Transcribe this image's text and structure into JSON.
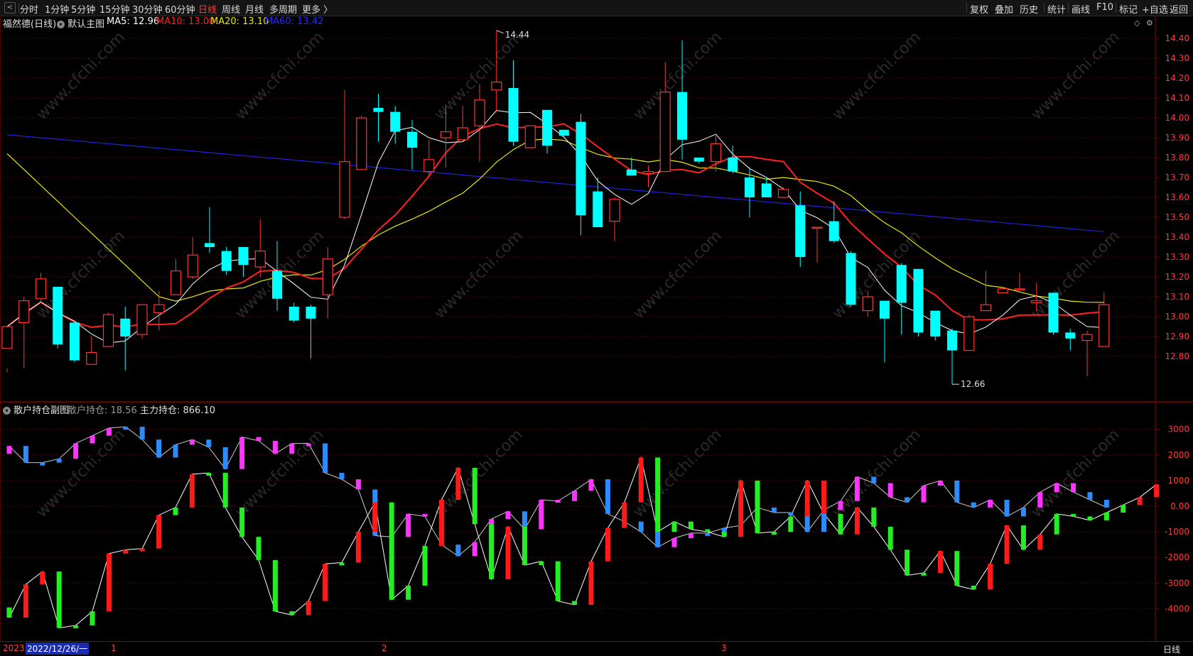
{
  "toolbar": {
    "periods": [
      "分时",
      "1分钟",
      "5分钟",
      "15分钟",
      "30分钟",
      "60分钟",
      "日线",
      "周线",
      "月线",
      "多周期",
      "更多 〉"
    ],
    "active_period": "日线",
    "right_buttons": [
      "复权",
      "叠加",
      "历史",
      "统计",
      "画线",
      "F10",
      "标记",
      "+自选",
      "返回"
    ]
  },
  "main_chart": {
    "stock_title": "福然德(日线)",
    "indicator_name": "默认主图",
    "ma_labels": [
      {
        "text": "MA5: 12.96",
        "color": "#ffffff"
      },
      {
        "text": "MA10: 13.00",
        "color": "#ff2020"
      },
      {
        "text": "MA20: 13.10",
        "color": "#e8e800"
      },
      {
        "text": "MA60: 13.42",
        "color": "#2a2aff"
      }
    ],
    "price_axis": [
      "14.40",
      "14.30",
      "14.20",
      "14.10",
      "14.00",
      "13.90",
      "13.80",
      "13.70",
      "13.60",
      "13.50",
      "13.40",
      "13.30",
      "13.20",
      "13.10",
      "13.00",
      "12.90",
      "12.80"
    ],
    "high_label": "14.44",
    "low_label": "12.66"
  },
  "sub_chart": {
    "indicator_name": "散户持仓副图",
    "label_retail": "散户持仓: 18.56",
    "label_main": "主力持仓: 866.10",
    "axis": [
      "3000",
      "2000",
      "1000",
      "0.00",
      "-1000",
      "-2000",
      "-3000",
      "-4000"
    ]
  },
  "bottom": {
    "year_label": "2023",
    "cursor_date": "2022/12/26/一",
    "month_marks": [
      "1",
      "2",
      "3"
    ],
    "period_label": "日线"
  },
  "watermark": "www.cfchi.com",
  "colors": {
    "up": "#ff3232",
    "down": "#00ffff",
    "ma5": "#ffffff",
    "ma10": "#ff2020",
    "ma20": "#e8e800",
    "ma60": "#2020e0",
    "grid": "#5a0000",
    "axis_line": "#8a0000"
  },
  "chart_data": {
    "type": "candlestick",
    "candles": [
      [
        12.84,
        12.95,
        12.74,
        12.72
      ],
      [
        12.97,
        13.08,
        13.1,
        12.74
      ],
      [
        13.09,
        13.19,
        13.22,
        13.07
      ],
      [
        13.15,
        12.86,
        13.15,
        12.84
      ],
      [
        12.97,
        12.78,
        12.97,
        12.77
      ],
      [
        12.76,
        12.82,
        12.9,
        12.76
      ],
      [
        12.85,
        13.01,
        13.02,
        12.85
      ],
      [
        12.99,
        12.9,
        13.05,
        12.73
      ],
      [
        12.91,
        13.06,
        13.06,
        12.89
      ],
      [
        13.02,
        13.06,
        13.13,
        12.93
      ],
      [
        13.11,
        13.23,
        13.29,
        13.11
      ],
      [
        13.2,
        13.31,
        13.4,
        13.19
      ],
      [
        13.37,
        13.35,
        13.55,
        13.32
      ],
      [
        13.33,
        13.23,
        13.35,
        13.21
      ],
      [
        13.35,
        13.26,
        13.35,
        13.2
      ],
      [
        13.25,
        13.33,
        13.49,
        13.2
      ],
      [
        13.23,
        13.09,
        13.38,
        13.03
      ],
      [
        13.05,
        12.98,
        13.07,
        12.97
      ],
      [
        13.05,
        12.99,
        13.06,
        12.79
      ],
      [
        13.11,
        13.29,
        13.35,
        12.99
      ],
      [
        13.5,
        13.78,
        14.14,
        13.49
      ],
      [
        13.74,
        14.0,
        14.01,
        13.74
      ],
      [
        14.05,
        14.03,
        14.12,
        13.88
      ],
      [
        14.03,
        13.93,
        14.06,
        13.87
      ],
      [
        13.93,
        13.85,
        13.99,
        13.74
      ],
      [
        13.73,
        13.79,
        13.89,
        13.7
      ],
      [
        13.9,
        13.93,
        14.06,
        13.75
      ],
      [
        13.89,
        13.95,
        14.06,
        13.88
      ],
      [
        13.96,
        14.09,
        14.17,
        13.78
      ],
      [
        14.14,
        14.18,
        14.44,
        14.03
      ],
      [
        14.15,
        13.88,
        14.29,
        13.86
      ],
      [
        13.85,
        13.96,
        13.96,
        13.85
      ],
      [
        14.04,
        13.86,
        14.04,
        13.82
      ],
      [
        13.94,
        13.91,
        13.94,
        13.91
      ],
      [
        13.98,
        13.51,
        14.02,
        13.41
      ],
      [
        13.63,
        13.45,
        13.7,
        13.45
      ],
      [
        13.48,
        13.59,
        13.6,
        13.38
      ],
      [
        13.74,
        13.71,
        13.8,
        13.71
      ],
      [
        13.72,
        13.73,
        13.76,
        13.65
      ],
      [
        13.73,
        14.13,
        14.28,
        13.73
      ],
      [
        14.13,
        13.89,
        14.39,
        13.79
      ],
      [
        13.8,
        13.78,
        13.8,
        13.77
      ],
      [
        13.78,
        13.87,
        13.91,
        13.73
      ],
      [
        13.8,
        13.73,
        13.86,
        13.72
      ],
      [
        13.7,
        13.6,
        13.75,
        13.5
      ],
      [
        13.67,
        13.6,
        13.7,
        13.6
      ],
      [
        13.6,
        13.64,
        13.65,
        13.6
      ],
      [
        13.56,
        13.3,
        13.63,
        13.25
      ],
      [
        13.45,
        13.45,
        13.45,
        13.27
      ],
      [
        13.48,
        13.38,
        13.58,
        13.37
      ],
      [
        13.32,
        13.06,
        13.33,
        13.05
      ],
      [
        13.03,
        13.1,
        13.13,
        13.0
      ],
      [
        13.08,
        12.99,
        13.08,
        12.77
      ],
      [
        13.26,
        13.07,
        13.27,
        12.91
      ],
      [
        13.24,
        12.92,
        13.24,
        12.9
      ],
      [
        13.03,
        12.9,
        13.03,
        12.88
      ],
      [
        12.93,
        12.83,
        12.94,
        12.66
      ],
      [
        12.83,
        13.0,
        13.01,
        12.83
      ],
      [
        13.03,
        13.06,
        13.23,
        13.03
      ],
      [
        13.12,
        13.14,
        13.15,
        13.12
      ],
      [
        13.14,
        13.14,
        13.22,
        13.14
      ],
      [
        13.07,
        13.08,
        13.17,
        13.03
      ],
      [
        13.12,
        12.92,
        13.12,
        12.91
      ],
      [
        12.92,
        12.89,
        12.94,
        12.83
      ],
      [
        12.88,
        12.91,
        12.93,
        12.7
      ],
      [
        12.85,
        13.06,
        13.12,
        12.85
      ]
    ],
    "retail_bars": [
      [
        2350,
        "m"
      ],
      [
        1700,
        "b"
      ],
      [
        1700,
        "b"
      ],
      [
        1850,
        "b"
      ],
      [
        2450,
        "m"
      ],
      [
        2750,
        "m"
      ],
      [
        3050,
        "m"
      ],
      [
        3100,
        "b"
      ],
      [
        2600,
        "b"
      ],
      [
        1900,
        "b"
      ],
      [
        2400,
        "b"
      ],
      [
        2600,
        "m"
      ],
      [
        2300,
        "b"
      ],
      [
        1450,
        "b"
      ],
      [
        2700,
        "m"
      ],
      [
        2550,
        "m"
      ],
      [
        2050,
        "m"
      ],
      [
        2450,
        "m"
      ],
      [
        2450,
        "m"
      ],
      [
        1300,
        "b"
      ],
      [
        1050,
        "b"
      ],
      [
        650,
        "m"
      ],
      [
        -1150,
        "b"
      ],
      [
        -1200,
        "b"
      ],
      [
        -300,
        "m"
      ],
      [
        -400,
        "m"
      ],
      [
        -1500,
        "b"
      ],
      [
        -1950,
        "b"
      ],
      [
        -1400,
        "m"
      ],
      [
        -500,
        "m"
      ],
      [
        -200,
        "m"
      ],
      [
        -900,
        "b"
      ],
      [
        250,
        "m"
      ],
      [
        200,
        "m"
      ],
      [
        600,
        "m"
      ],
      [
        1050,
        "m"
      ],
      [
        -300,
        "b"
      ],
      [
        -600,
        "b"
      ],
      [
        -1000,
        "b"
      ],
      [
        -1600,
        "b"
      ],
      [
        -1250,
        "m"
      ],
      [
        -1050,
        "m"
      ],
      [
        -1050,
        "b"
      ],
      [
        -850,
        "b"
      ],
      [
        -750,
        "b"
      ],
      [
        -50,
        "m"
      ],
      [
        -250,
        "b"
      ],
      [
        -250,
        "b"
      ],
      [
        -1000,
        "b"
      ],
      [
        -150,
        "b"
      ],
      [
        200,
        "m"
      ],
      [
        1150,
        "m"
      ],
      [
        900,
        "b"
      ],
      [
        350,
        "m"
      ],
      [
        150,
        "b"
      ],
      [
        800,
        "m"
      ],
      [
        1000,
        "m"
      ],
      [
        150,
        "b"
      ],
      [
        -50,
        "b"
      ],
      [
        250,
        "m"
      ],
      [
        -400,
        "b"
      ],
      [
        -50,
        "b"
      ],
      [
        550,
        "m"
      ],
      [
        900,
        "m"
      ],
      [
        550,
        "m"
      ],
      [
        250,
        "b"
      ],
      [
        -50,
        "b"
      ]
    ],
    "main_bars": [
      [
        -4350,
        "g"
      ],
      [
        -3050,
        "r"
      ],
      [
        -2550,
        "r"
      ],
      [
        -4750,
        "g"
      ],
      [
        -4650,
        "g"
      ],
      [
        -4100,
        "g"
      ],
      [
        -1850,
        "r"
      ],
      [
        -1700,
        "r"
      ],
      [
        -1650,
        "r"
      ],
      [
        -350,
        "r"
      ],
      [
        -50,
        "g"
      ],
      [
        1250,
        "r"
      ],
      [
        1300,
        "g"
      ],
      [
        -50,
        "g"
      ],
      [
        -1200,
        "g"
      ],
      [
        -2100,
        "g"
      ],
      [
        -4100,
        "g"
      ],
      [
        -4250,
        "g"
      ],
      [
        -3700,
        "r"
      ],
      [
        -2250,
        "r"
      ],
      [
        -2200,
        "g"
      ],
      [
        -1000,
        "r"
      ],
      [
        150,
        "r"
      ],
      [
        -3650,
        "g"
      ],
      [
        -3100,
        "g"
      ],
      [
        -1550,
        "g"
      ],
      [
        250,
        "r"
      ],
      [
        1500,
        "r"
      ],
      [
        -700,
        "g"
      ],
      [
        -2850,
        "g"
      ],
      [
        -800,
        "r"
      ],
      [
        -2300,
        "g"
      ],
      [
        -2150,
        "g"
      ],
      [
        -3700,
        "g"
      ],
      [
        -3850,
        "g"
      ],
      [
        -2150,
        "r"
      ],
      [
        -850,
        "r"
      ],
      [
        150,
        "r"
      ],
      [
        1900,
        "r"
      ],
      [
        -1000,
        "g"
      ],
      [
        -600,
        "g"
      ],
      [
        -900,
        "g"
      ],
      [
        -1000,
        "g"
      ],
      [
        -1200,
        "g"
      ],
      [
        1000,
        "r"
      ],
      [
        -1050,
        "g"
      ],
      [
        -1000,
        "g"
      ],
      [
        -400,
        "g"
      ],
      [
        1000,
        "r"
      ],
      [
        -300,
        "r"
      ],
      [
        -1100,
        "g"
      ],
      [
        -50,
        "r"
      ],
      [
        -800,
        "g"
      ],
      [
        -1700,
        "g"
      ],
      [
        -2700,
        "g"
      ],
      [
        -2600,
        "g"
      ],
      [
        -1750,
        "r"
      ],
      [
        -3100,
        "g"
      ],
      [
        -3250,
        "g"
      ],
      [
        -2250,
        "r"
      ],
      [
        -750,
        "r"
      ],
      [
        -1700,
        "g"
      ],
      [
        -1100,
        "r"
      ],
      [
        -300,
        "g"
      ],
      [
        -400,
        "g"
      ],
      [
        -550,
        "g"
      ],
      [
        -250,
        "g"
      ],
      [
        50,
        "g"
      ],
      [
        350,
        "r"
      ],
      [
        850,
        "r"
      ]
    ]
  }
}
